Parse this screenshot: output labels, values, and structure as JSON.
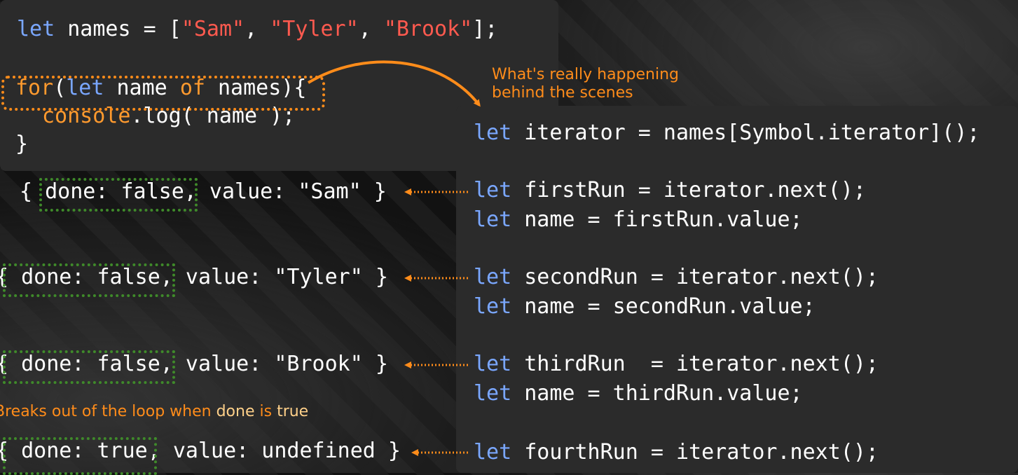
{
  "source": {
    "line1": {
      "kw": "let",
      "mid": " names = [",
      "s1": "\"Sam\"",
      "sep1": ", ",
      "s2": "\"Tyler\"",
      "sep2": ", ",
      "s3": "\"Brook\"",
      "end": "];"
    },
    "line2": {
      "for": "for",
      "open": "(",
      "kw": "let",
      "mid": " name ",
      "of": "of",
      "end": " names){"
    },
    "line3": {
      "fn": "console",
      "end": ".log( name );"
    },
    "line4": "}"
  },
  "annotation": {
    "line1": "What's really happening",
    "line2": "behind the scenes"
  },
  "behind": {
    "iterator": {
      "kw": "let",
      "text": " iterator = names[Symbol.iterator]();"
    },
    "first_next": {
      "kw": "let",
      "text": " firstRun = iterator.next();"
    },
    "first_value": {
      "kw": "let",
      "text": " name = firstRun.value;"
    },
    "second_next": {
      "kw": "let",
      "text": " secondRun = iterator.next();"
    },
    "second_value": {
      "kw": "let",
      "text": " name = secondRun.value;"
    },
    "third_next": {
      "kw": "let",
      "text": " thirdRun  = iterator.next();"
    },
    "third_value": {
      "kw": "let",
      "text": " name = thirdRun.value;"
    },
    "fourth_next": {
      "kw": "let",
      "text": " fourthRun = iterator.next();"
    }
  },
  "results": [
    "{ done: false, value: \"Sam\" }",
    "{ done: false, value: \"Tyler\" }",
    "{ done: false, value: \"Brook\" }",
    "{ done: true, value: undefined }"
  ],
  "breaks_note": {
    "pre": "Breaks out of the loop when ",
    "done": "done",
    "mid": " is ",
    "true": "true"
  },
  "colors": {
    "accent": "#ff8c1a",
    "keyword": "#7aa7ff",
    "string": "#ff5a4f",
    "dotted_green": "#3f8a2a"
  }
}
